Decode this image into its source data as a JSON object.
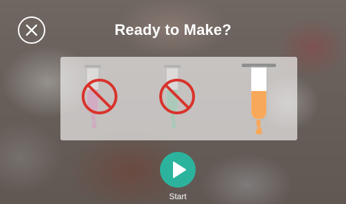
{
  "dialog": {
    "title": "Ready to Make?",
    "close_icon": "close-icon",
    "start": {
      "icon": "play-icon",
      "label": "Start",
      "color": "#2bb39d"
    }
  },
  "tubes": [
    {
      "name": "pink",
      "color": "#e58fc6",
      "status": "unavailable",
      "icon": "prohibited-icon"
    },
    {
      "name": "green",
      "color": "#86d6b0",
      "status": "unavailable",
      "icon": "prohibited-icon"
    },
    {
      "name": "orange",
      "color": "#f7a85a",
      "status": "available",
      "icon": "test-tube-icon"
    }
  ],
  "colors": {
    "prohibited": "#d8332b",
    "accent": "#2bb39d"
  }
}
